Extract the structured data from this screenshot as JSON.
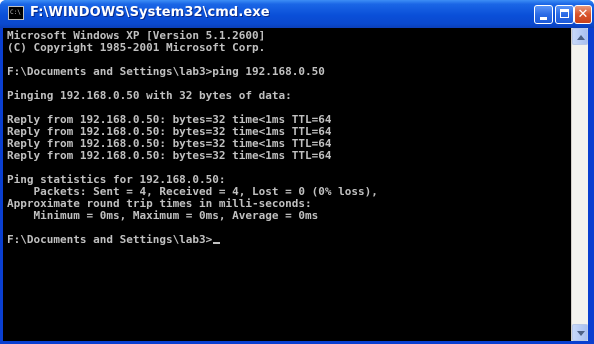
{
  "window": {
    "title": "F:\\WINDOWS\\System32\\cmd.exe",
    "icon_text": "C:\\"
  },
  "console": {
    "lines": [
      "Microsoft Windows XP [Version 5.1.2600]",
      "(C) Copyright 1985-2001 Microsoft Corp.",
      "",
      "F:\\Documents and Settings\\lab3>ping 192.168.0.50",
      "",
      "Pinging 192.168.0.50 with 32 bytes of data:",
      "",
      "Reply from 192.168.0.50: bytes=32 time<1ms TTL=64",
      "Reply from 192.168.0.50: bytes=32 time<1ms TTL=64",
      "Reply from 192.168.0.50: bytes=32 time<1ms TTL=64",
      "Reply from 192.168.0.50: bytes=32 time<1ms TTL=64",
      "",
      "Ping statistics for 192.168.0.50:",
      "    Packets: Sent = 4, Received = 4, Lost = 0 (0% loss),",
      "Approximate round trip times in milli-seconds:",
      "    Minimum = 0ms, Maximum = 0ms, Average = 0ms",
      "",
      "F:\\Documents and Settings\\lab3>"
    ]
  },
  "colors": {
    "title_bar": "#0a4fd8",
    "console_bg": "#000000",
    "console_text": "#c0c0c0",
    "close_button": "#d9542b"
  },
  "icons": {
    "app": "cmd-icon",
    "minimize": "minimize-icon",
    "maximize": "maximize-icon",
    "close": "close-icon",
    "scroll_up": "arrow-up-icon",
    "scroll_down": "arrow-down-icon"
  }
}
